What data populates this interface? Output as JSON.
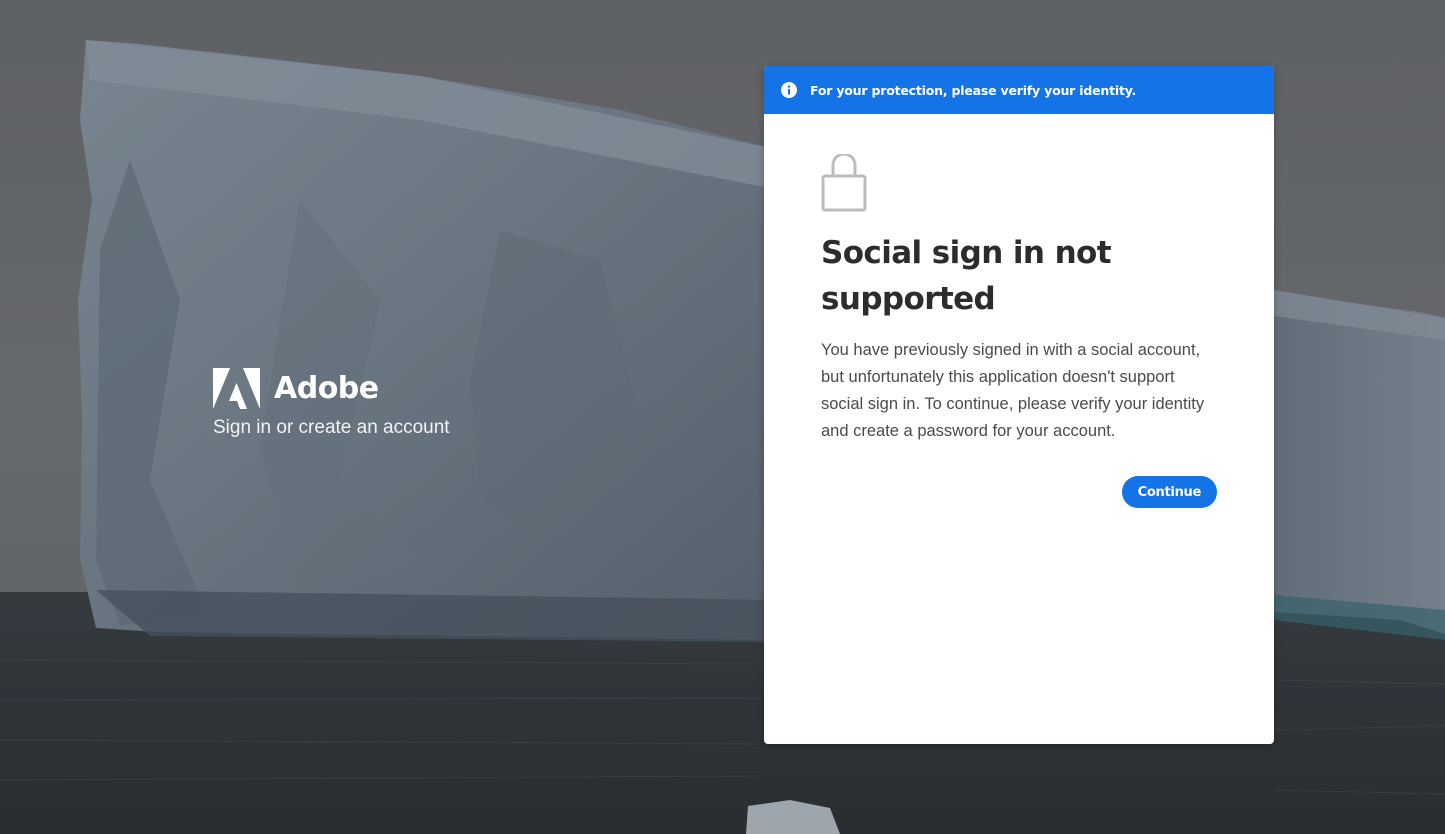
{
  "branding": {
    "logo_icon": "adobe-logo-icon",
    "name": "Adobe",
    "tagline": "Sign in or create an account"
  },
  "banner": {
    "icon": "info-icon",
    "text": "For your protection, please verify your identity."
  },
  "card": {
    "icon": "lock-icon",
    "heading": "Social sign in not supported",
    "message": "You have previously signed in with a social account, but unfortunately this application doesn't support social sign in. To continue, please verify your identity and create a password for your account.",
    "continue_label": "Continue"
  },
  "colors": {
    "accent": "#1473e6",
    "heading": "#2c2c2c",
    "body_text": "#4b4b4b"
  }
}
